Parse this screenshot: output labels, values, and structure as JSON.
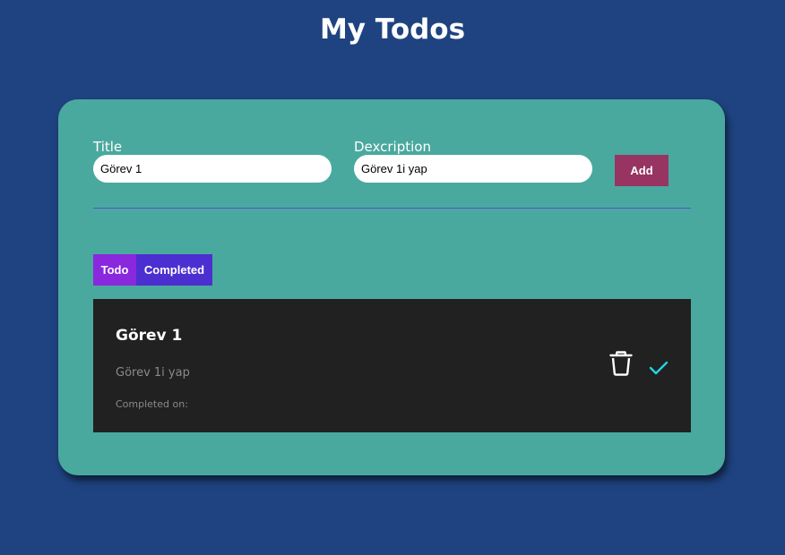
{
  "header": {
    "title": "My Todos"
  },
  "form": {
    "title_label": "Title",
    "title_value": "Görev 1",
    "description_label": "Dexcription",
    "description_value": "Görev 1i yap",
    "add_label": "Add"
  },
  "tabs": [
    {
      "label": "Todo",
      "active": true
    },
    {
      "label": "Completed",
      "active": false
    }
  ],
  "todos": [
    {
      "title": "Görev 1",
      "description": "Görev 1i yap",
      "completed_on": "Completed on:"
    }
  ],
  "icons": {
    "delete": "trash-icon",
    "complete": "check-icon"
  },
  "colors": {
    "background": "#1e4380",
    "card": "#4aa99e",
    "add_button": "#973462",
    "tab_active": "#8a28de",
    "tab_inactive": "#4c2fd0",
    "todo_item": "#212121",
    "check": "#22d3e6"
  }
}
